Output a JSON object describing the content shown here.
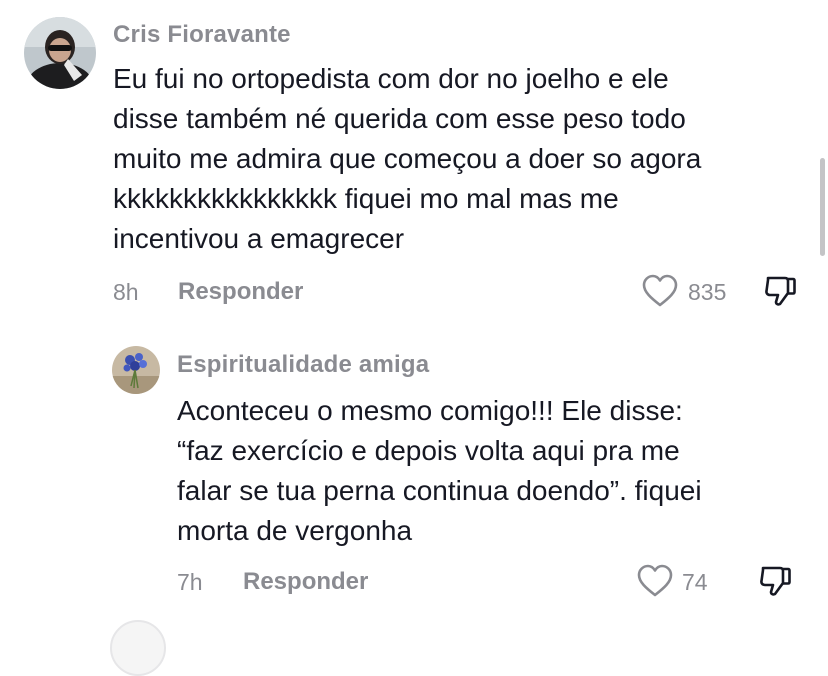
{
  "comments": [
    {
      "username": "Cris Fioravante",
      "lines": [
        "Eu fui no ortopedista com dor no joelho e ele",
        "disse também né querida com esse peso todo",
        "muito me admira que começou a doer so agora",
        "kkkkkkkkkkkkkkkk fiquei mo mal mas me",
        "incentivou a emagrecer"
      ],
      "time": "8h",
      "reply_label": "Responder",
      "likes": "835"
    },
    {
      "username": "Espiritualidade amiga",
      "lines": [
        "Aconteceu o mesmo comigo!!! Ele disse:",
        "“faz exercício e depois volta aqui pra me",
        "falar se tua perna continua doendo”. fiquei",
        "morta de vergonha"
      ],
      "time": "7h",
      "reply_label": "Responder",
      "likes": "74"
    }
  ],
  "icons": {
    "like": "heart-outline-icon",
    "dislike": "thumbs-down-outline-icon"
  },
  "colors": {
    "text": "#161823",
    "secondary": "#8a8b91"
  }
}
